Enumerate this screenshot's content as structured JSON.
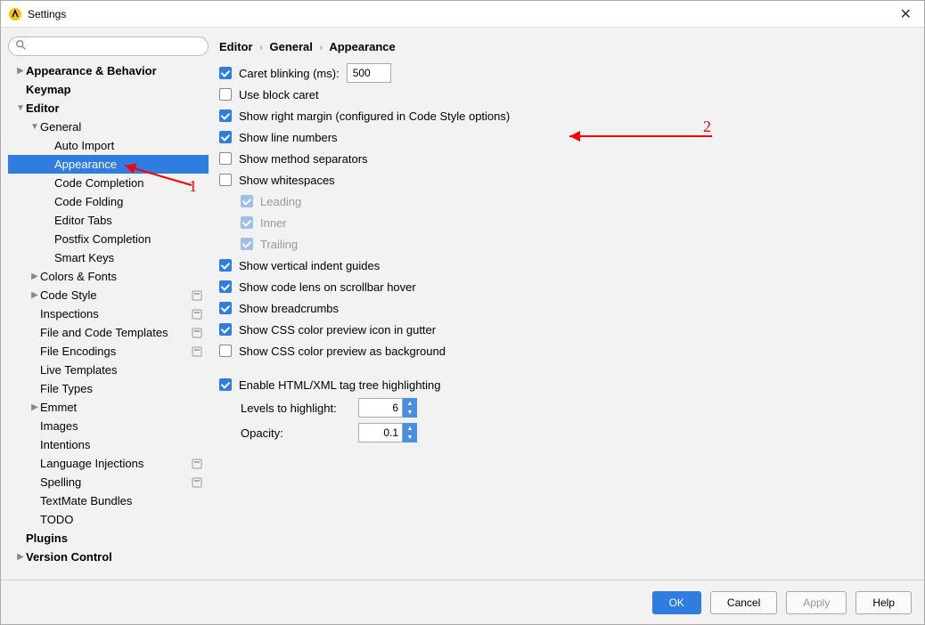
{
  "window": {
    "title": "Settings"
  },
  "breadcrumb": [
    "Editor",
    "General",
    "Appearance"
  ],
  "sidebar": {
    "search_placeholder": "",
    "items": [
      {
        "label": "Appearance & Behavior",
        "bold": true,
        "indent": 0,
        "arrow": "▶"
      },
      {
        "label": "Keymap",
        "bold": true,
        "indent": 0,
        "arrow": ""
      },
      {
        "label": "Editor",
        "bold": true,
        "indent": 0,
        "arrow": "▼"
      },
      {
        "label": "General",
        "bold": false,
        "indent": 1,
        "arrow": "▼"
      },
      {
        "label": "Auto Import",
        "bold": false,
        "indent": 2,
        "arrow": ""
      },
      {
        "label": "Appearance",
        "bold": false,
        "indent": 2,
        "arrow": "",
        "selected": true
      },
      {
        "label": "Code Completion",
        "bold": false,
        "indent": 2,
        "arrow": ""
      },
      {
        "label": "Code Folding",
        "bold": false,
        "indent": 2,
        "arrow": ""
      },
      {
        "label": "Editor Tabs",
        "bold": false,
        "indent": 2,
        "arrow": ""
      },
      {
        "label": "Postfix Completion",
        "bold": false,
        "indent": 2,
        "arrow": ""
      },
      {
        "label": "Smart Keys",
        "bold": false,
        "indent": 2,
        "arrow": ""
      },
      {
        "label": "Colors & Fonts",
        "bold": false,
        "indent": 1,
        "arrow": "▶"
      },
      {
        "label": "Code Style",
        "bold": false,
        "indent": 1,
        "arrow": "▶",
        "badge": true
      },
      {
        "label": "Inspections",
        "bold": false,
        "indent": 1,
        "arrow": "",
        "badge": true
      },
      {
        "label": "File and Code Templates",
        "bold": false,
        "indent": 1,
        "arrow": "",
        "badge": true
      },
      {
        "label": "File Encodings",
        "bold": false,
        "indent": 1,
        "arrow": "",
        "badge": true
      },
      {
        "label": "Live Templates",
        "bold": false,
        "indent": 1,
        "arrow": ""
      },
      {
        "label": "File Types",
        "bold": false,
        "indent": 1,
        "arrow": ""
      },
      {
        "label": "Emmet",
        "bold": false,
        "indent": 1,
        "arrow": "▶"
      },
      {
        "label": "Images",
        "bold": false,
        "indent": 1,
        "arrow": ""
      },
      {
        "label": "Intentions",
        "bold": false,
        "indent": 1,
        "arrow": ""
      },
      {
        "label": "Language Injections",
        "bold": false,
        "indent": 1,
        "arrow": "",
        "badge": true
      },
      {
        "label": "Spelling",
        "bold": false,
        "indent": 1,
        "arrow": "",
        "badge": true
      },
      {
        "label": "TextMate Bundles",
        "bold": false,
        "indent": 1,
        "arrow": ""
      },
      {
        "label": "TODO",
        "bold": false,
        "indent": 1,
        "arrow": ""
      },
      {
        "label": "Plugins",
        "bold": true,
        "indent": 0,
        "arrow": ""
      },
      {
        "label": "Version Control",
        "bold": true,
        "indent": 0,
        "arrow": "▶"
      }
    ]
  },
  "options": {
    "caret_blinking_label": "Caret blinking (ms):",
    "caret_blinking_value": "500",
    "use_block_caret": "Use block caret",
    "show_right_margin": "Show right margin (configured in Code Style options)",
    "show_line_numbers": "Show line numbers",
    "show_method_separators": "Show method separators",
    "show_whitespaces": "Show whitespaces",
    "leading": "Leading",
    "inner": "Inner",
    "trailing": "Trailing",
    "show_vertical_indent": "Show vertical indent guides",
    "show_code_lens": "Show code lens on scrollbar hover",
    "show_breadcrumbs": "Show breadcrumbs",
    "show_css_gutter": "Show CSS color preview icon in gutter",
    "show_css_bg": "Show CSS color preview as background",
    "enable_html_xml": "Enable HTML/XML tag tree highlighting",
    "levels_label": "Levels to highlight:",
    "levels_value": "6",
    "opacity_label": "Opacity:",
    "opacity_value": "0.1"
  },
  "buttons": {
    "ok": "OK",
    "cancel": "Cancel",
    "apply": "Apply",
    "help": "Help"
  },
  "annotations": {
    "num1": "1",
    "num2": "2"
  }
}
